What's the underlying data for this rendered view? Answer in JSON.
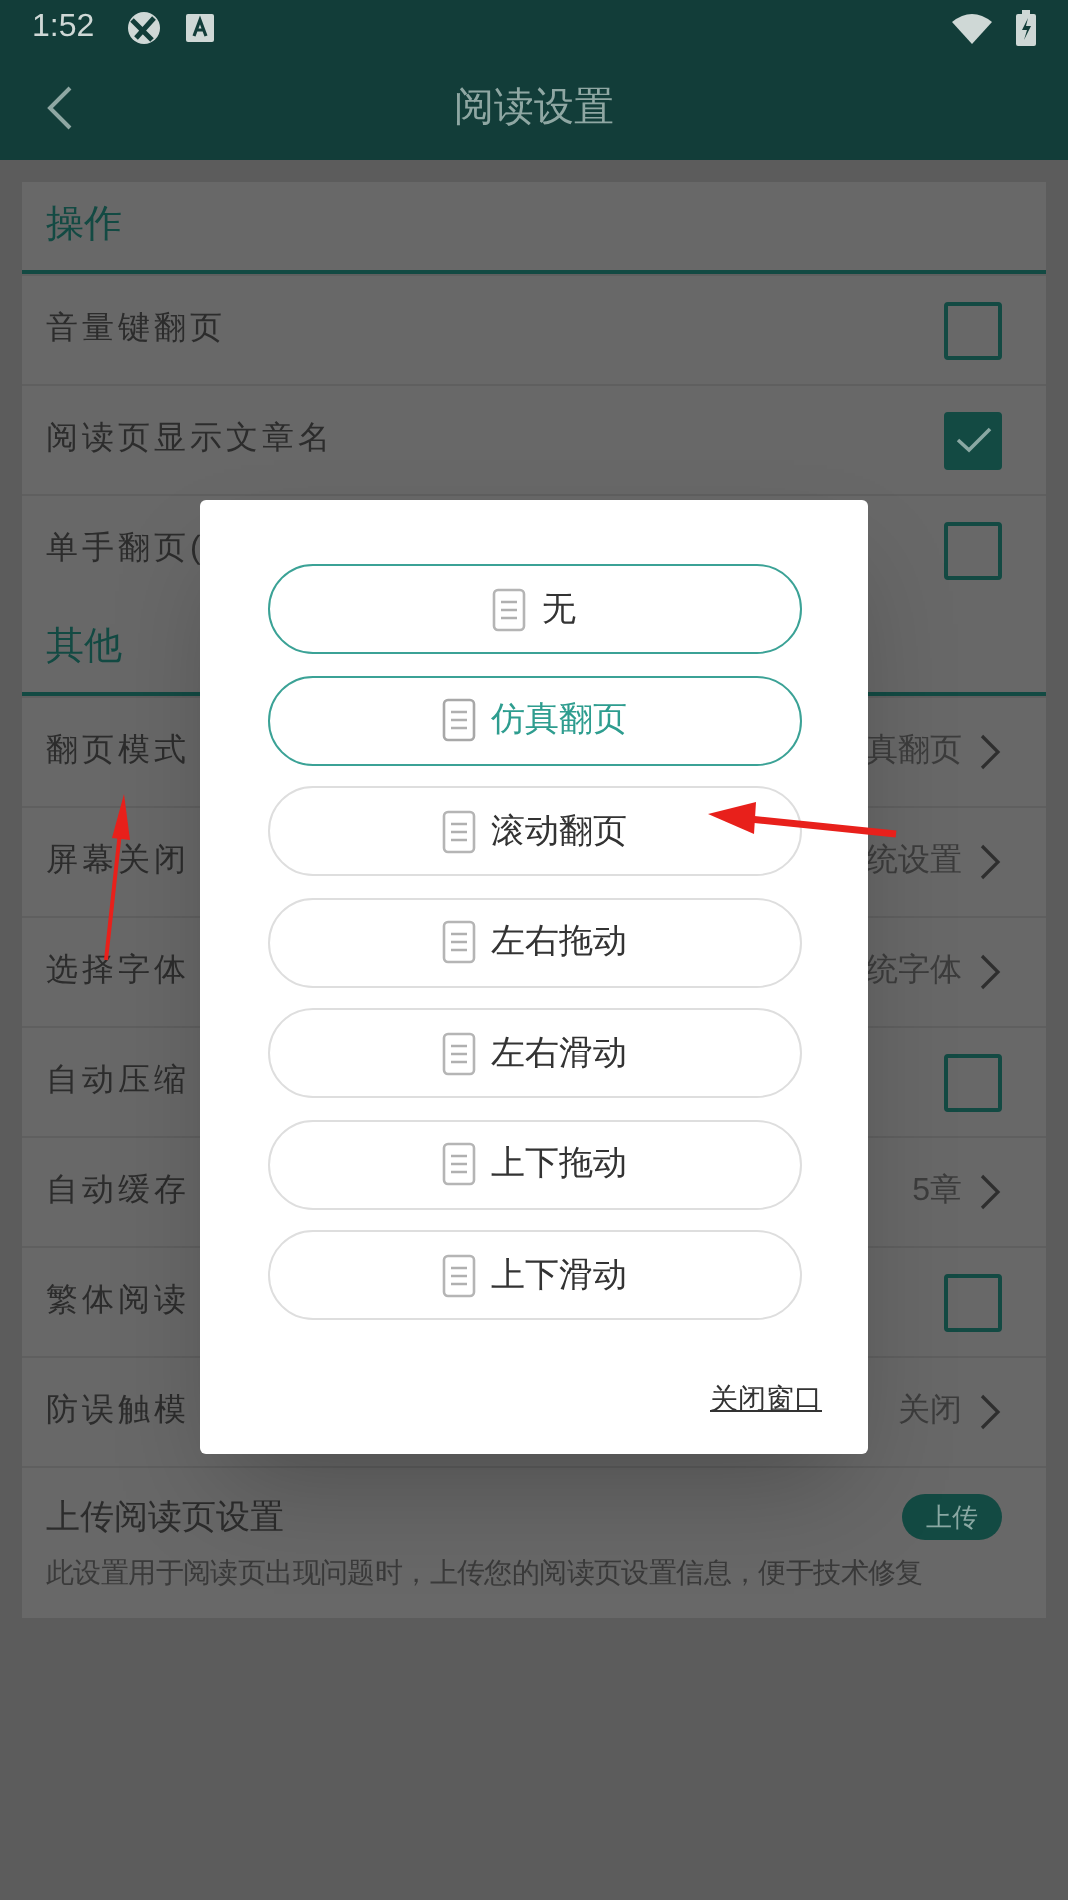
{
  "status_bar": {
    "time": "1:52"
  },
  "header": {
    "title": "阅读设置"
  },
  "sections": [
    {
      "title": "操作",
      "items": [
        {
          "kind": "checkbox",
          "label": "音量键翻页",
          "checked": false
        },
        {
          "kind": "checkbox",
          "label": "阅读页显示文章名",
          "checked": true
        },
        {
          "kind": "checkbox",
          "label": "单手翻页(",
          "checked": false
        }
      ]
    },
    {
      "title": "其他",
      "items": [
        {
          "kind": "value",
          "label": "翻页模式",
          "value": "真翻页"
        },
        {
          "kind": "value",
          "label": "屏幕关闭",
          "value": "统设置"
        },
        {
          "kind": "value",
          "label": "选择字体",
          "value": "统字体"
        },
        {
          "kind": "checkbox",
          "label": "自动压缩",
          "checked": false
        },
        {
          "kind": "value",
          "label": "自动缓存",
          "value": "5章"
        },
        {
          "kind": "checkbox",
          "label": "繁体阅读",
          "checked": false
        },
        {
          "kind": "value",
          "label": "防误触模",
          "value": "关闭"
        }
      ]
    }
  ],
  "upload": {
    "title": "上传阅读页设置",
    "button": "上传",
    "description": "此设置用于阅读页出现问题时，上传您的阅读页设置信息，便于技术修复"
  },
  "dialog": {
    "options": [
      {
        "label": "无",
        "selected": false,
        "highlighted": true
      },
      {
        "label": "仿真翻页",
        "selected": true,
        "highlighted": true
      },
      {
        "label": "滚动翻页",
        "selected": false,
        "highlighted": false
      },
      {
        "label": "左右拖动",
        "selected": false,
        "highlighted": false
      },
      {
        "label": "左右滑动",
        "selected": false,
        "highlighted": false
      },
      {
        "label": "上下拖动",
        "selected": false,
        "highlighted": false
      },
      {
        "label": "上下滑动",
        "selected": false,
        "highlighted": false
      }
    ],
    "close": "关闭窗口"
  }
}
